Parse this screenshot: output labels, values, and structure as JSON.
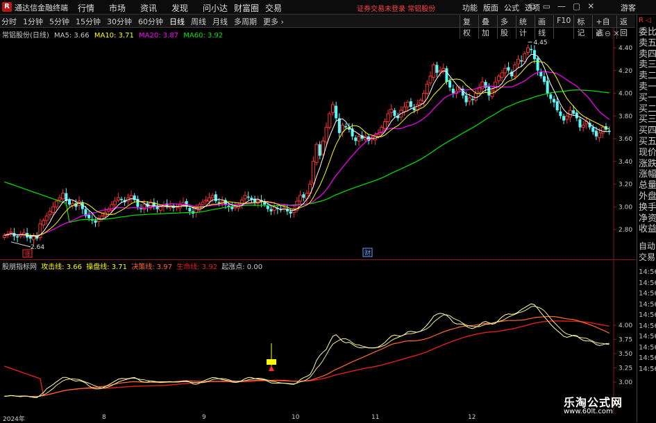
{
  "app": {
    "logo_text": "R",
    "title": "通达信金融终端"
  },
  "menu": [
    "行情",
    "市场",
    "资讯",
    "发现",
    "问小达",
    "财富圈",
    "交易"
  ],
  "notice": "证券交易未登录  常铝股份",
  "right_menu": [
    "功能",
    "版面",
    "公式",
    "选项"
  ],
  "window_icons": [
    "⧉",
    "▭",
    "—",
    "▢",
    "✕"
  ],
  "guest_label": "游客",
  "periods": [
    "分时",
    "1分钟",
    "5分钟",
    "15分钟",
    "30分钟",
    "60分钟",
    "日线",
    "周线",
    "月线",
    "多周期",
    "更多 ›"
  ],
  "active_period": "日线",
  "tools": [
    "复权",
    "叠加",
    "多股",
    "统计",
    "画线",
    "F10",
    "标记",
    "+自选",
    "返回"
  ],
  "right_panel": {
    "top": "R ◁",
    "items": [
      "委比",
      "卖五",
      "卖四",
      "卖三",
      "卖二",
      "卖一",
      "买一",
      "买二",
      "买三",
      "买四",
      "买五",
      "现价",
      "涨跌",
      "涨幅",
      "总量",
      "外盘",
      "换手",
      "净资",
      "收益"
    ],
    "items2": [
      "自动",
      "交易"
    ],
    "times": [
      "14:56",
      "14:56",
      "14:56",
      "14:56",
      "14:56",
      "14:56",
      "14:56",
      "14:56",
      "14:56",
      "14:56"
    ]
  },
  "main_legend": {
    "stock": "常铝股份(日线)",
    "ma5": "MA5: 3.66",
    "ma10": "MA10: 3.71",
    "ma20": "MA20: 3.87",
    "ma60": "MA60: 3.92",
    "pane_icons": "⊕ ⊖ ✕"
  },
  "indicator_legend": {
    "name": "股朋指标网",
    "attack": "攻击线: 3.66",
    "operate": "操盘线: 3.71",
    "decision": "决策线: 3.97",
    "life": "生命线: 3.92",
    "rise": "起涨点: 0.00"
  },
  "annotations": {
    "high": "4.45",
    "low": "2.64",
    "limit_tag": "涨",
    "finance_tag": "财"
  },
  "main_yaxis": [
    "4.40",
    "4.20",
    "4.00",
    "3.80",
    "3.60",
    "3.40",
    "3.20",
    "3.00",
    "2.80"
  ],
  "ind_yaxis": [
    "4.00",
    "3.75",
    "3.50",
    "3.25",
    "3.00"
  ],
  "xaxis": [
    "2024年",
    "8",
    "9",
    "10",
    "11",
    "12"
  ],
  "watermark": {
    "line1": "乐淘公式网",
    "line2": "www.60lt.com"
  },
  "colors": {
    "up": "#ff3232",
    "down": "#54fcfc",
    "ma5": "#ffffff",
    "ma10": "#ffff00",
    "ma20": "#ff00ff",
    "ma60": "#00e600",
    "decision": "#ff6a2f",
    "life": "#e02020"
  },
  "chart_data": {
    "type": "candlestick",
    "price_range": [
      2.64,
      4.45
    ],
    "close": [
      2.75,
      2.76,
      2.78,
      2.74,
      2.73,
      2.76,
      2.77,
      2.73,
      2.72,
      2.74,
      2.72,
      2.85,
      2.88,
      2.92,
      2.96,
      3.0,
      3.05,
      3.08,
      3.12,
      3.05,
      3.02,
      3.03,
      3.0,
      3.05,
      2.98,
      2.92,
      2.9,
      2.88,
      2.86,
      2.9,
      2.92,
      2.95,
      2.98,
      3.02,
      3.05,
      3.08,
      3.06,
      3.04,
      3.08,
      3.1,
      3.06,
      3.0,
      2.98,
      3.02,
      3.0,
      3.04,
      3.0,
      2.98,
      3.0,
      3.02,
      3.0,
      3.01,
      2.99,
      3.0,
      3.02,
      3.04,
      3.0,
      2.96,
      2.94,
      2.98,
      3.02,
      3.04,
      3.06,
      3.08,
      3.1,
      3.05,
      3.03,
      3.05,
      3.02,
      3.0,
      2.98,
      3.0,
      3.02,
      3.06,
      3.1,
      3.08,
      3.06,
      3.04,
      3.06,
      3.04,
      3.02,
      2.98,
      2.96,
      3.0,
      2.98,
      2.97,
      2.99,
      2.96,
      2.94,
      2.98,
      3.05,
      3.1,
      3.08,
      3.12,
      3.2,
      3.4,
      3.55,
      3.45,
      3.58,
      3.7,
      3.82,
      3.9,
      3.78,
      3.65,
      3.72,
      3.7,
      3.68,
      3.62,
      3.58,
      3.62,
      3.6,
      3.62,
      3.58,
      3.6,
      3.62,
      3.64,
      3.7,
      3.75,
      3.82,
      3.86,
      3.8,
      3.78,
      3.85,
      3.88,
      3.92,
      3.88,
      3.85,
      3.9,
      3.94,
      4.0,
      4.08,
      4.15,
      4.25,
      4.18,
      4.2,
      4.22,
      4.1,
      4.05,
      4.0,
      4.02,
      4.05,
      3.98,
      3.92,
      3.96,
      3.94,
      4.0,
      4.05,
      4.1,
      4.05,
      3.98,
      4.02,
      4.1,
      4.15,
      4.18,
      4.22,
      4.2,
      4.15,
      4.25,
      4.3,
      4.28,
      4.35,
      4.4,
      4.38,
      4.3,
      4.2,
      4.15,
      4.1,
      4.0,
      3.95,
      3.92,
      3.85,
      3.8,
      3.76,
      3.8,
      3.85,
      3.82,
      3.78,
      3.7,
      3.72,
      3.75,
      3.7,
      3.66,
      3.62,
      3.65,
      3.7,
      3.68,
      3.66
    ]
  }
}
